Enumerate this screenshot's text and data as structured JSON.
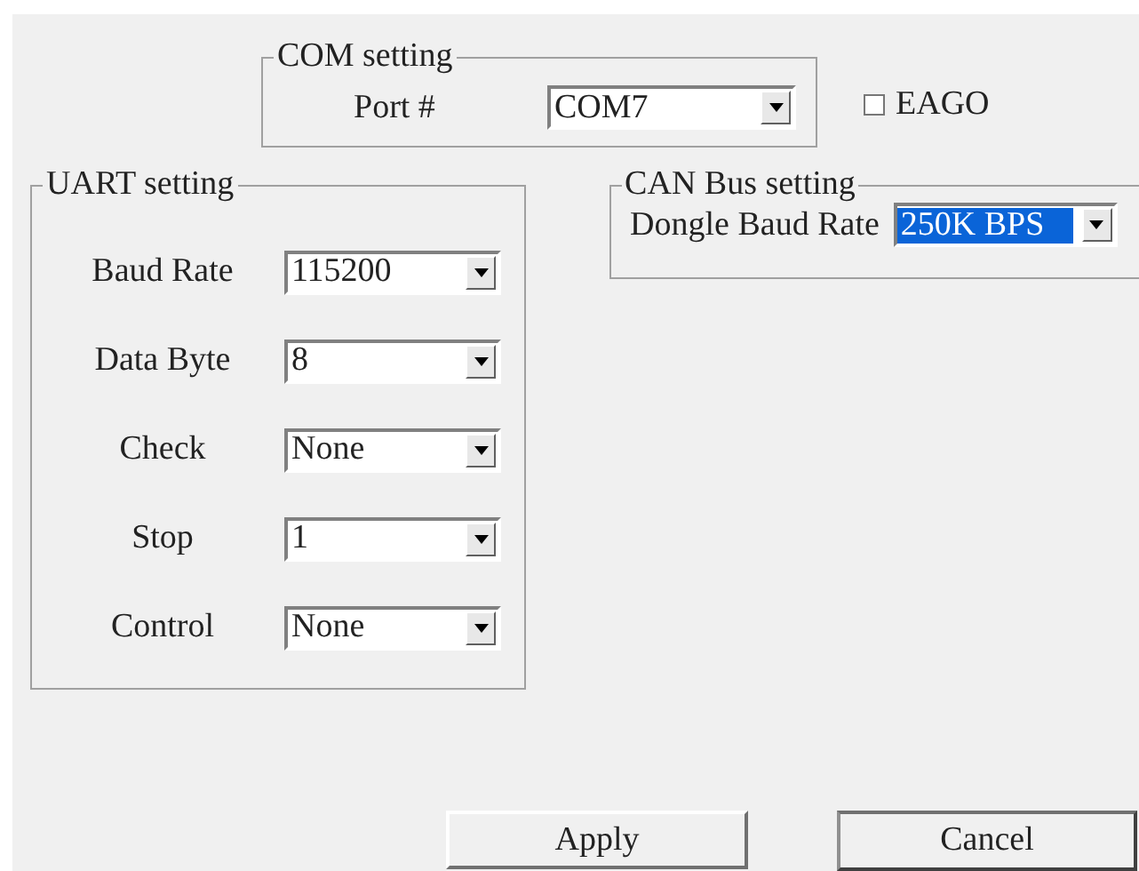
{
  "com_setting": {
    "title": "COM setting",
    "port_label": "Port #",
    "port_value": "COM7"
  },
  "eago": {
    "label": "EAGO",
    "checked": false
  },
  "uart_setting": {
    "title": "UART setting",
    "fields": [
      {
        "label": "Baud Rate",
        "value": "115200"
      },
      {
        "label": "Data Byte",
        "value": "8"
      },
      {
        "label": "Check",
        "value": "None"
      },
      {
        "label": "Stop",
        "value": "1"
      },
      {
        "label": "Control",
        "value": "None"
      }
    ]
  },
  "can_bus_setting": {
    "title": "CAN Bus setting",
    "label": "Dongle Baud Rate",
    "value": "250K BPS",
    "selected": true
  },
  "buttons": [
    "Apply",
    "Cancel"
  ]
}
